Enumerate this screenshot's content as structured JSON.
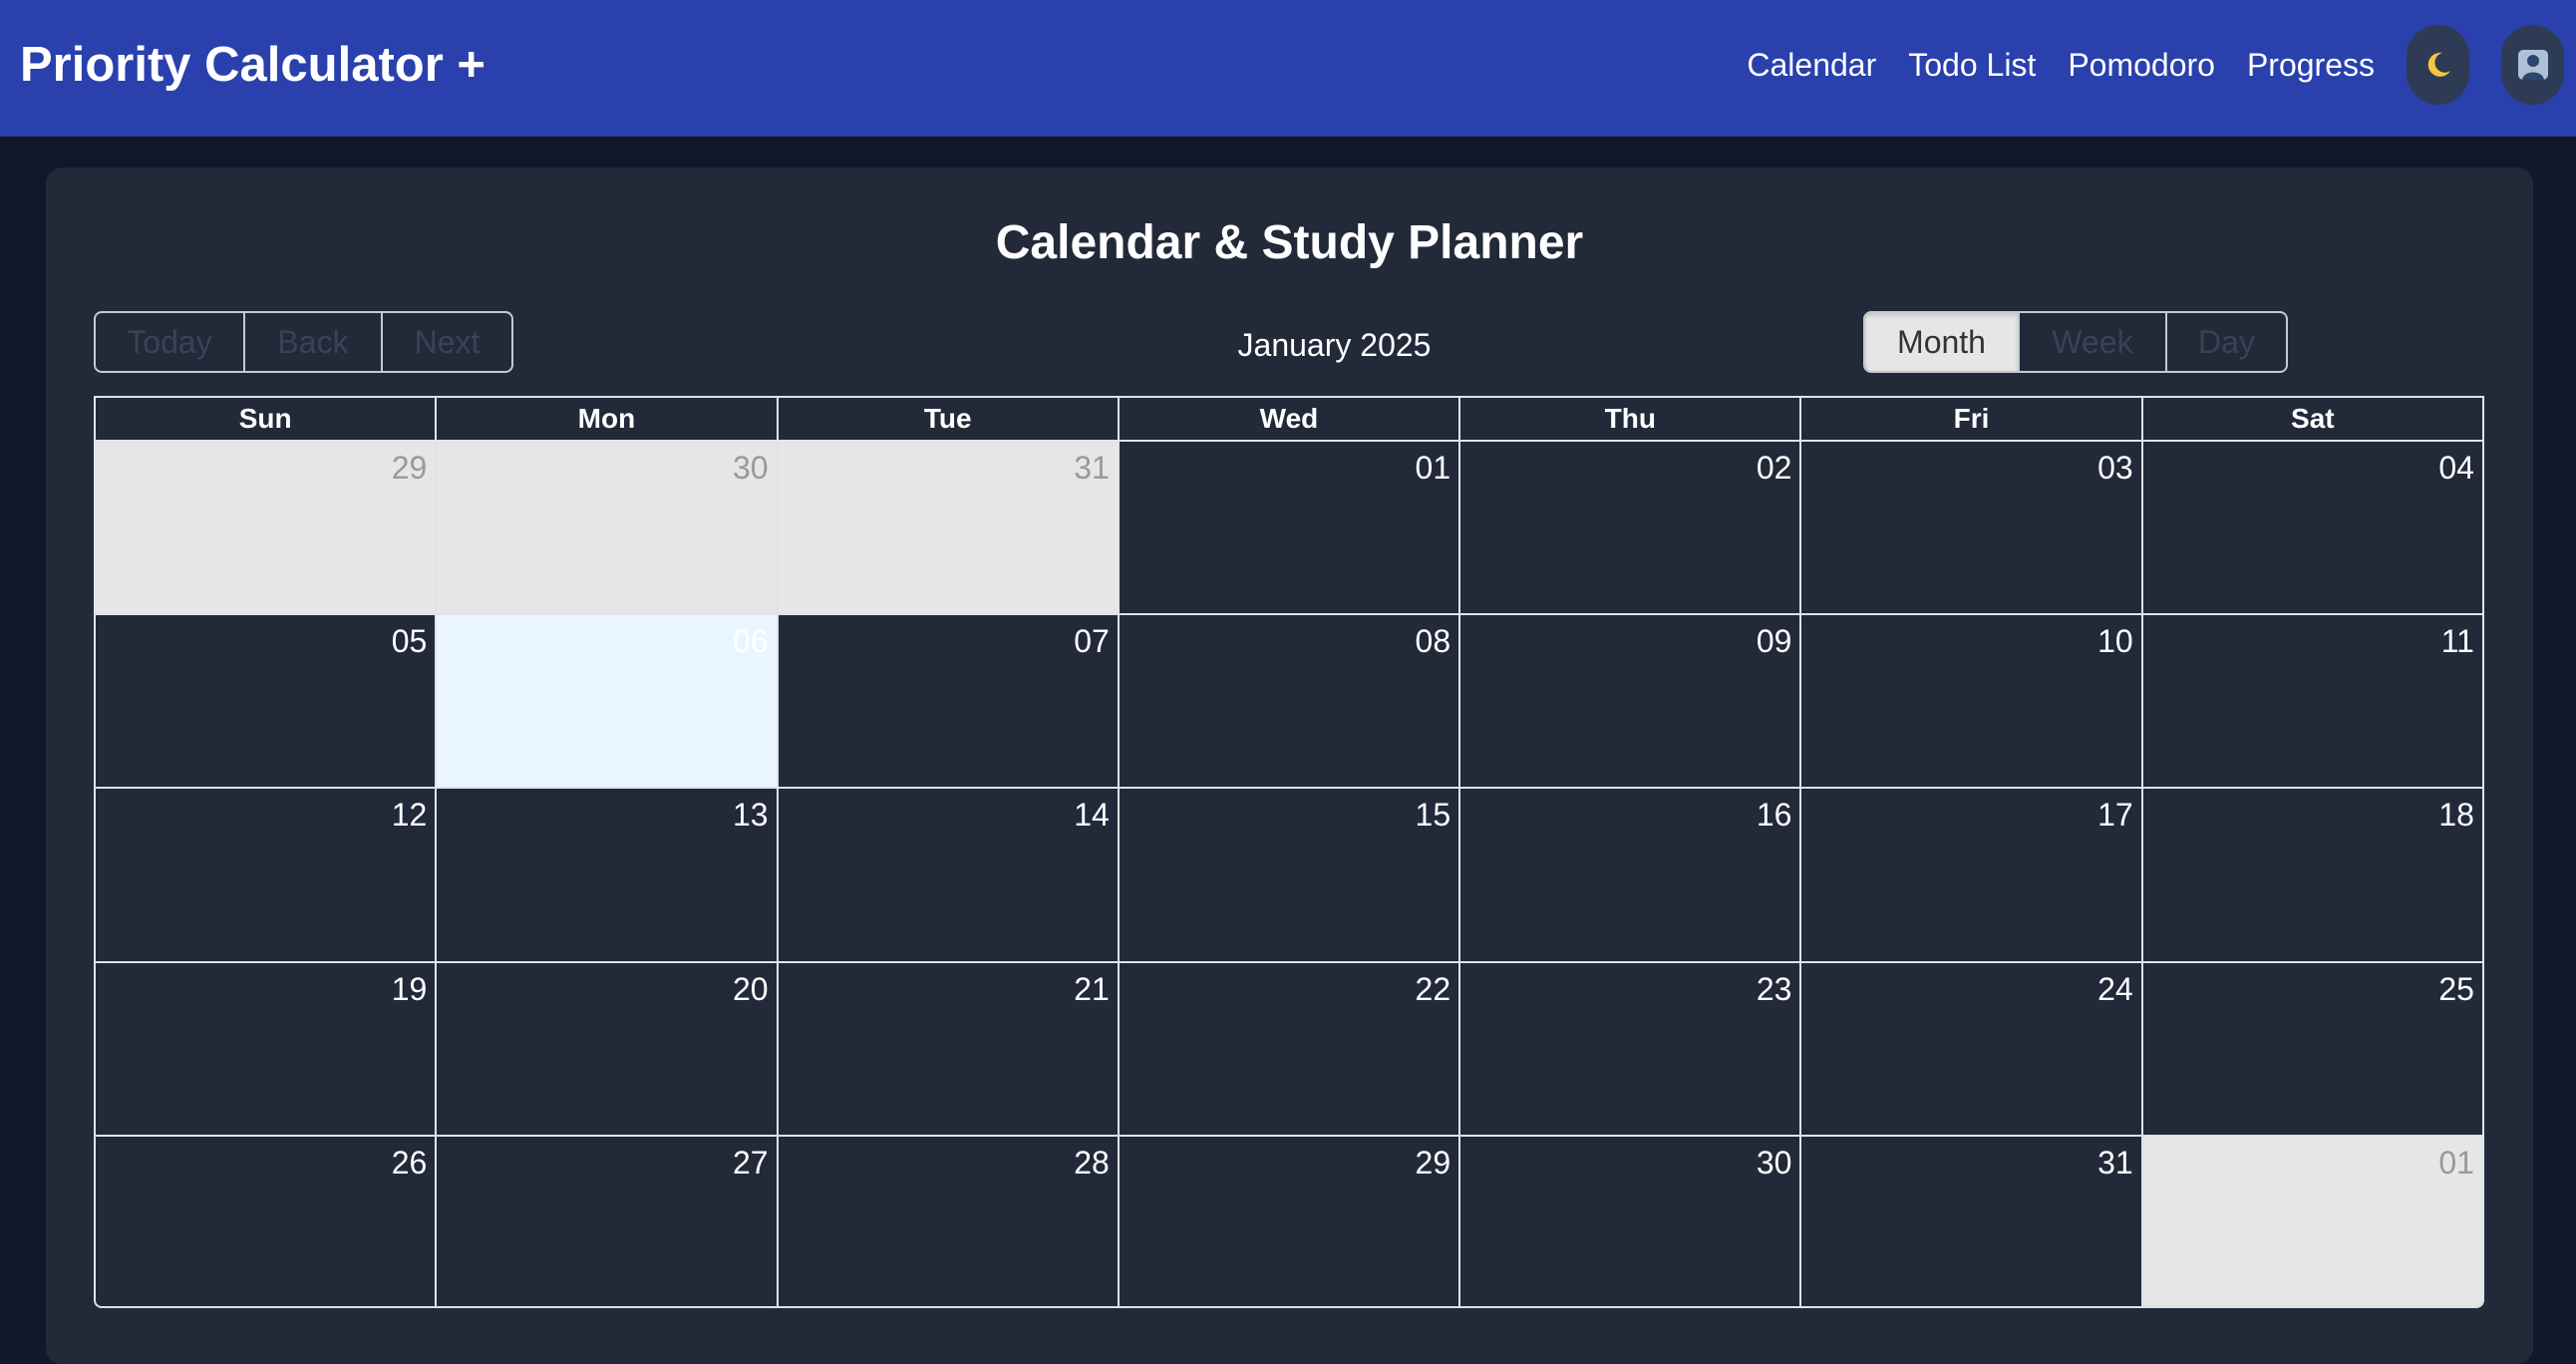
{
  "navbar": {
    "brand": "Priority Calculator +",
    "links": [
      "Calendar",
      "Todo List",
      "Pomodoro",
      "Progress"
    ],
    "theme_icon": "moon-icon",
    "profile_icon": "user-icon"
  },
  "page": {
    "title": "Calendar & Study Planner"
  },
  "toolbar": {
    "nav_buttons": [
      "Today",
      "Back",
      "Next"
    ],
    "label": "January 2025",
    "views": [
      "Month",
      "Week",
      "Day"
    ],
    "active_view": "Month"
  },
  "calendar": {
    "weekdays": [
      "Sun",
      "Mon",
      "Tue",
      "Wed",
      "Thu",
      "Fri",
      "Sat"
    ],
    "weeks": [
      [
        {
          "d": "29",
          "off": true
        },
        {
          "d": "30",
          "off": true
        },
        {
          "d": "31",
          "off": true
        },
        {
          "d": "01"
        },
        {
          "d": "02"
        },
        {
          "d": "03"
        },
        {
          "d": "04"
        }
      ],
      [
        {
          "d": "05"
        },
        {
          "d": "06",
          "today": true
        },
        {
          "d": "07"
        },
        {
          "d": "08"
        },
        {
          "d": "09"
        },
        {
          "d": "10"
        },
        {
          "d": "11"
        }
      ],
      [
        {
          "d": "12"
        },
        {
          "d": "13"
        },
        {
          "d": "14"
        },
        {
          "d": "15"
        },
        {
          "d": "16"
        },
        {
          "d": "17"
        },
        {
          "d": "18"
        }
      ],
      [
        {
          "d": "19"
        },
        {
          "d": "20"
        },
        {
          "d": "21"
        },
        {
          "d": "22"
        },
        {
          "d": "23"
        },
        {
          "d": "24"
        },
        {
          "d": "25"
        }
      ],
      [
        {
          "d": "26"
        },
        {
          "d": "27"
        },
        {
          "d": "28"
        },
        {
          "d": "29"
        },
        {
          "d": "30"
        },
        {
          "d": "31"
        },
        {
          "d": "01",
          "off": true
        }
      ]
    ]
  }
}
